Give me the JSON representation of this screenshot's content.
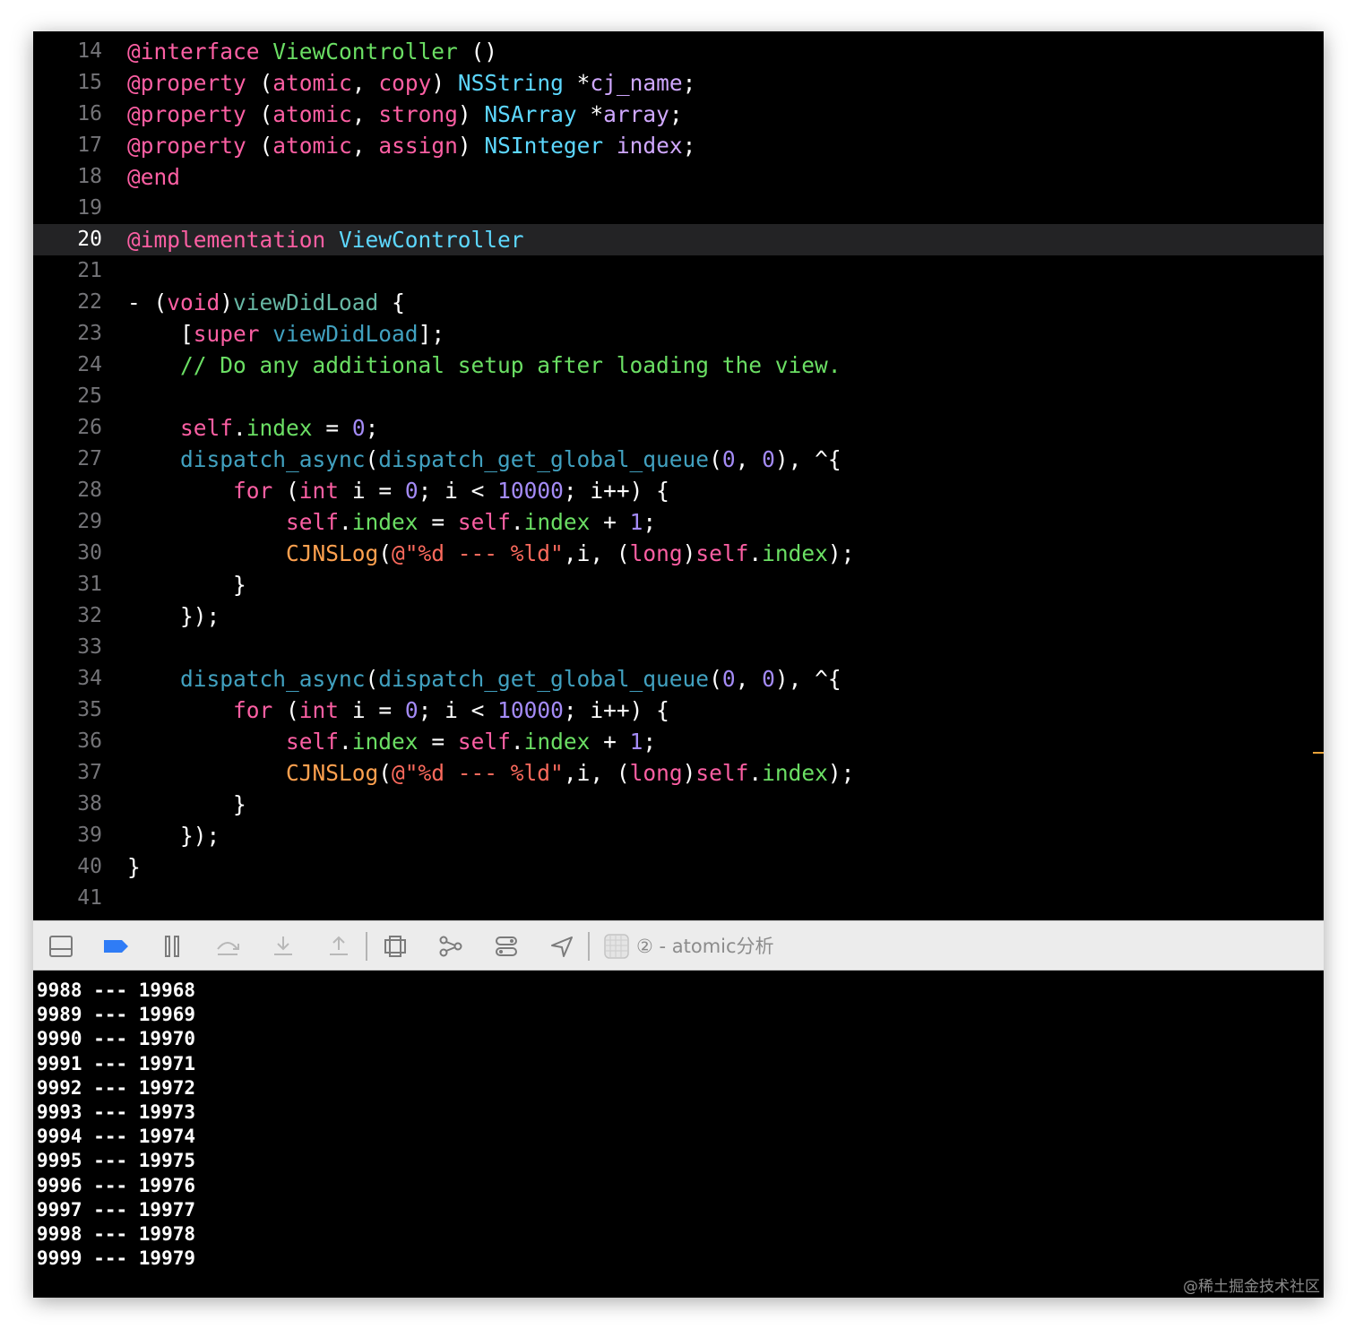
{
  "editor": {
    "current_line": "20",
    "lines": [
      {
        "n": "14",
        "tokens": [
          [
            "kw",
            "@interface"
          ],
          [
            "pu",
            " "
          ],
          [
            "cm",
            "ViewController"
          ],
          [
            "pu",
            " ()"
          ]
        ]
      },
      {
        "n": "15",
        "tokens": [
          [
            "kw",
            "@property"
          ],
          [
            "pu",
            " ("
          ],
          [
            "kw",
            "atomic"
          ],
          [
            "pu",
            ", "
          ],
          [
            "kw",
            "copy"
          ],
          [
            "pu",
            ") "
          ],
          [
            "tp",
            "NSString"
          ],
          [
            "pu",
            " *"
          ],
          [
            "cl",
            "cj_name"
          ],
          [
            "pu",
            ";"
          ]
        ]
      },
      {
        "n": "16",
        "tokens": [
          [
            "kw",
            "@property"
          ],
          [
            "pu",
            " ("
          ],
          [
            "kw",
            "atomic"
          ],
          [
            "pu",
            ", "
          ],
          [
            "kw",
            "strong"
          ],
          [
            "pu",
            ") "
          ],
          [
            "tp",
            "NSArray"
          ],
          [
            "pu",
            " *"
          ],
          [
            "cl",
            "array"
          ],
          [
            "pu",
            ";"
          ]
        ]
      },
      {
        "n": "17",
        "tokens": [
          [
            "kw",
            "@property"
          ],
          [
            "pu",
            " ("
          ],
          [
            "kw",
            "atomic"
          ],
          [
            "pu",
            ", "
          ],
          [
            "kw",
            "assign"
          ],
          [
            "pu",
            ") "
          ],
          [
            "tp",
            "NSInteger"
          ],
          [
            "pu",
            " "
          ],
          [
            "cl",
            "index"
          ],
          [
            "pu",
            ";"
          ]
        ]
      },
      {
        "n": "18",
        "tokens": [
          [
            "kw",
            "@end"
          ]
        ]
      },
      {
        "n": "19",
        "tokens": []
      },
      {
        "n": "20",
        "tokens": [
          [
            "kw",
            "@implementation"
          ],
          [
            "pu",
            " "
          ],
          [
            "tp",
            "ViewController"
          ]
        ]
      },
      {
        "n": "21",
        "tokens": []
      },
      {
        "n": "22",
        "tokens": [
          [
            "pu",
            "- ("
          ],
          [
            "kw",
            "void"
          ],
          [
            "pu",
            ")"
          ],
          [
            "gr",
            "viewDidLoad"
          ],
          [
            "pu",
            " {"
          ]
        ]
      },
      {
        "n": "23",
        "tokens": [
          [
            "pu",
            "    ["
          ],
          [
            "kw",
            "super"
          ],
          [
            "pu",
            " "
          ],
          [
            "fn",
            "viewDidLoad"
          ],
          [
            "pu",
            "];"
          ]
        ]
      },
      {
        "n": "24",
        "tokens": [
          [
            "cm",
            "    // Do any additional setup after loading the view."
          ]
        ]
      },
      {
        "n": "25",
        "tokens": []
      },
      {
        "n": "26",
        "tokens": [
          [
            "pu",
            "    "
          ],
          [
            "kw",
            "self"
          ],
          [
            "pu",
            "."
          ],
          [
            "cm",
            "index"
          ],
          [
            "pu",
            " = "
          ],
          [
            "nb",
            "0"
          ],
          [
            "pu",
            ";"
          ]
        ]
      },
      {
        "n": "27",
        "tokens": [
          [
            "pu",
            "    "
          ],
          [
            "fn",
            "dispatch_async"
          ],
          [
            "pu",
            "("
          ],
          [
            "fn",
            "dispatch_get_global_queue"
          ],
          [
            "pu",
            "("
          ],
          [
            "nb",
            "0"
          ],
          [
            "pu",
            ", "
          ],
          [
            "nb",
            "0"
          ],
          [
            "pu",
            "), ^{"
          ]
        ]
      },
      {
        "n": "28",
        "tokens": [
          [
            "pu",
            "        "
          ],
          [
            "kw",
            "for"
          ],
          [
            "pu",
            " ("
          ],
          [
            "kw",
            "int"
          ],
          [
            "pu",
            " i = "
          ],
          [
            "nb",
            "0"
          ],
          [
            "pu",
            "; i < "
          ],
          [
            "nb",
            "10000"
          ],
          [
            "pu",
            "; i++) {"
          ]
        ]
      },
      {
        "n": "29",
        "tokens": [
          [
            "pu",
            "            "
          ],
          [
            "kw",
            "self"
          ],
          [
            "pu",
            "."
          ],
          [
            "cm",
            "index"
          ],
          [
            "pu",
            " = "
          ],
          [
            "kw",
            "self"
          ],
          [
            "pu",
            "."
          ],
          [
            "cm",
            "index"
          ],
          [
            "pu",
            " + "
          ],
          [
            "nb",
            "1"
          ],
          [
            "pu",
            ";"
          ]
        ]
      },
      {
        "n": "30",
        "tokens": [
          [
            "pu",
            "            "
          ],
          [
            "or",
            "CJNSLog"
          ],
          [
            "pu",
            "("
          ],
          [
            "st",
            "@\"%d --- %ld\""
          ],
          [
            "pu",
            ",i, ("
          ],
          [
            "kw",
            "long"
          ],
          [
            "pu",
            ")"
          ],
          [
            "kw",
            "self"
          ],
          [
            "pu",
            "."
          ],
          [
            "cm",
            "index"
          ],
          [
            "pu",
            ");"
          ]
        ]
      },
      {
        "n": "31",
        "tokens": [
          [
            "pu",
            "        }"
          ]
        ]
      },
      {
        "n": "32",
        "tokens": [
          [
            "pu",
            "    });"
          ]
        ]
      },
      {
        "n": "33",
        "tokens": []
      },
      {
        "n": "34",
        "tokens": [
          [
            "pu",
            "    "
          ],
          [
            "fn",
            "dispatch_async"
          ],
          [
            "pu",
            "("
          ],
          [
            "fn",
            "dispatch_get_global_queue"
          ],
          [
            "pu",
            "("
          ],
          [
            "nb",
            "0"
          ],
          [
            "pu",
            ", "
          ],
          [
            "nb",
            "0"
          ],
          [
            "pu",
            "), ^{"
          ]
        ]
      },
      {
        "n": "35",
        "tokens": [
          [
            "pu",
            "        "
          ],
          [
            "kw",
            "for"
          ],
          [
            "pu",
            " ("
          ],
          [
            "kw",
            "int"
          ],
          [
            "pu",
            " i = "
          ],
          [
            "nb",
            "0"
          ],
          [
            "pu",
            "; i < "
          ],
          [
            "nb",
            "10000"
          ],
          [
            "pu",
            "; i++) {"
          ]
        ]
      },
      {
        "n": "36",
        "tokens": [
          [
            "pu",
            "            "
          ],
          [
            "kw",
            "self"
          ],
          [
            "pu",
            "."
          ],
          [
            "cm",
            "index"
          ],
          [
            "pu",
            " = "
          ],
          [
            "kw",
            "self"
          ],
          [
            "pu",
            "."
          ],
          [
            "cm",
            "index"
          ],
          [
            "pu",
            " + "
          ],
          [
            "nb",
            "1"
          ],
          [
            "pu",
            ";"
          ]
        ]
      },
      {
        "n": "37",
        "tokens": [
          [
            "pu",
            "            "
          ],
          [
            "or",
            "CJNSLog"
          ],
          [
            "pu",
            "("
          ],
          [
            "st",
            "@\"%d --- %ld\""
          ],
          [
            "pu",
            ",i, ("
          ],
          [
            "kw",
            "long"
          ],
          [
            "pu",
            ")"
          ],
          [
            "kw",
            "self"
          ],
          [
            "pu",
            "."
          ],
          [
            "cm",
            "index"
          ],
          [
            "pu",
            ");"
          ]
        ]
      },
      {
        "n": "38",
        "tokens": [
          [
            "pu",
            "        }"
          ]
        ]
      },
      {
        "n": "39",
        "tokens": [
          [
            "pu",
            "    });"
          ]
        ]
      },
      {
        "n": "40",
        "tokens": [
          [
            "pu",
            "}"
          ]
        ]
      },
      {
        "n": "41",
        "tokens": []
      }
    ]
  },
  "toolbar": {
    "scheme_label": "② - atomic分析",
    "icons": [
      "hide-debug-area-icon",
      "breakpoints-icon",
      "pause-icon",
      "step-over-icon",
      "step-into-icon",
      "step-out-icon",
      "view-hierarchy-icon",
      "memory-graph-icon",
      "environment-overrides-icon",
      "simulate-location-icon"
    ]
  },
  "console": {
    "lines": [
      "9988 --- 19968",
      "9989 --- 19969",
      "9990 --- 19970",
      "9991 --- 19971",
      "9992 --- 19972",
      "9993 --- 19973",
      "9994 --- 19974",
      "9995 --- 19975",
      "9996 --- 19976",
      "9997 --- 19977",
      "9998 --- 19978",
      "9999 --- 19979"
    ]
  },
  "watermark": "@稀土掘金技术社区"
}
